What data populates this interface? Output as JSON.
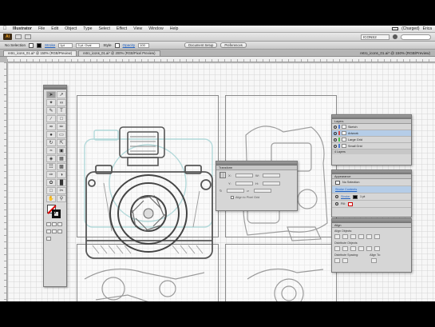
{
  "menubar": {
    "apple": "",
    "app": "Illustrator",
    "menus": [
      "File",
      "Edit",
      "Object",
      "Type",
      "Select",
      "Effect",
      "View",
      "Window",
      "Help"
    ],
    "status": "(Charged)",
    "user": "Erica"
  },
  "appbar": {
    "logo": "Ai",
    "workspace": "ICONS2",
    "search_placeholder": ""
  },
  "controlbar": {
    "selection": "No Selection",
    "stroke_label": "Stroke",
    "stroke_value": "1pt",
    "brush_value": "3 pt. Oval",
    "style_label": "Style",
    "opacity_label": "Opacity",
    "opacity_value": "100",
    "doc_setup": "Document Setup",
    "preferences": "Preferences"
  },
  "tabs": [
    {
      "label": "retro_icons_01.ai* @ 150% (RGB/Preview)",
      "active": true
    },
    {
      "label": "retro_icons_01.ai* @ 200% (RGB/Pixel Preview)",
      "active": false
    }
  ],
  "doc_title": "retro_icons_01.ai* @ 150% (RGB/Preview)",
  "transform": {
    "tab": "Transform",
    "labels": {
      "x": "X:",
      "y": "Y:",
      "w": "W:",
      "h": "H:"
    },
    "align_to_pixel": "Align to Pixel Grid"
  },
  "layers": {
    "tab": "Layers",
    "items": [
      {
        "name": "Sketch",
        "color": "#4a78d0",
        "selected": false
      },
      {
        "name": "Artwork",
        "color": "#d04a4a",
        "selected": true
      },
      {
        "name": "Large Grid",
        "color": "#4ac04a",
        "selected": false
      },
      {
        "name": "Small Grid",
        "color": "#4a78d0",
        "selected": false
      }
    ],
    "footer": "4 Layers"
  },
  "appearance": {
    "tab": "Appearance",
    "rows": [
      {
        "label": "No Selection",
        "type": "header"
      },
      {
        "label": "Stroke Contents",
        "type": "link"
      },
      {
        "label": "Stroke:",
        "value": "1 pt",
        "type": "stroke"
      },
      {
        "label": "Fill:",
        "type": "fill"
      }
    ]
  },
  "align": {
    "tab": "Align",
    "align_objects": "Align Objects:",
    "distribute_objects": "Distribute Objects:",
    "distribute_spacing": "Distribute Spacing:",
    "align_to": "Align To:"
  }
}
